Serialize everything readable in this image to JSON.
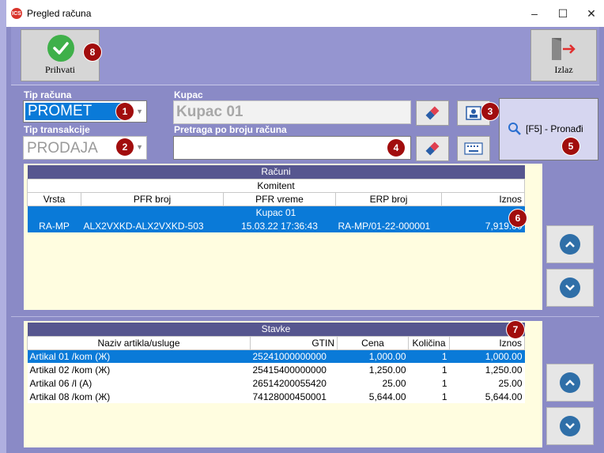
{
  "window": {
    "title": "Pregled računa",
    "icon_text": "ICS",
    "minimize": "–",
    "maximize": "☐",
    "close": "✕"
  },
  "toolbar": {
    "accept_label": "Prihvati",
    "exit_label": "Izlaz"
  },
  "badges": {
    "b1": "1",
    "b2": "2",
    "b3": "3",
    "b4": "4",
    "b5": "5",
    "b6": "6",
    "b7": "7",
    "b8": "8"
  },
  "form": {
    "tip_racuna_label": "Tip računa",
    "tip_racuna_value": "PROMET",
    "tip_transakcije_label": "Tip transakcije",
    "tip_transakcije_value": "PRODAJA",
    "kupac_label": "Kupac",
    "kupac_value": "Kupac 01",
    "pretraga_label": "Pretraga po broju računa",
    "pretraga_value": "",
    "find_label": "[F5] - Pronađi"
  },
  "racuni": {
    "title": "Računi",
    "group_header": "Komitent",
    "columns": [
      "Vrsta",
      "PFR broj",
      "PFR vreme",
      "ERP broj",
      "Iznos"
    ],
    "group_row": "Kupac 01",
    "rows": [
      {
        "vrsta": "RA-MP",
        "pfr_broj": "ALX2VXKD-ALX2VXKD-503",
        "pfr_vreme": "15.03.22 17:36:43",
        "erp_broj": "RA-MP/01-22-000001",
        "iznos": "7,919.00"
      }
    ]
  },
  "stavke": {
    "title": "Stavke",
    "columns": [
      "Naziv artikla/usluge",
      "GTIN",
      "Cena",
      "Količina",
      "Iznos"
    ],
    "rows": [
      {
        "naziv": "Artikal 01 /kom (Ж)",
        "gtin": "25241000000000",
        "cena": "1,000.00",
        "kolicina": "1",
        "iznos": "1,000.00"
      },
      {
        "naziv": "Artikal 02 /kom (Ж)",
        "gtin": "25415400000000",
        "cena": "1,250.00",
        "kolicina": "1",
        "iznos": "1,250.00"
      },
      {
        "naziv": "Artikal 06 /l (А)",
        "gtin": "26514200055420",
        "cena": "25.00",
        "kolicina": "1",
        "iznos": "25.00"
      },
      {
        "naziv": "Artikal 08 /kom (Ж)",
        "gtin": "74128000450001",
        "cena": "5,644.00",
        "kolicina": "1",
        "iznos": "5,644.00"
      }
    ]
  },
  "colors": {
    "accent": "#0a7ad8",
    "header": "#56568f",
    "badge": "#a10d0d",
    "background": "#8a8ac6"
  }
}
